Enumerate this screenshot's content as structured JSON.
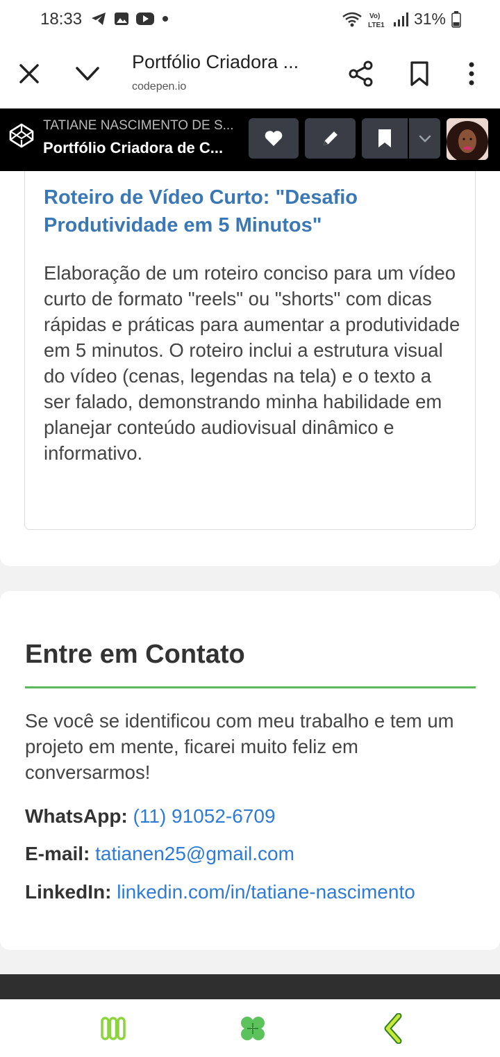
{
  "status_bar": {
    "time": "18:33",
    "battery": "31%"
  },
  "browser": {
    "title": "Portfólio Criadora ...",
    "domain": "codepen.io"
  },
  "codepen": {
    "author": "TATIANE NASCIMENTO DE S...",
    "pen_title": "Portfólio Criadora de C..."
  },
  "project": {
    "title": "Roteiro de Vídeo Curto: \"Desafio Produtividade em 5 Minutos\"",
    "description": "Elaboração de um roteiro conciso para um vídeo curto de formato \"reels\" ou \"shorts\" com dicas rápidas e práticas para aumentar a produtividade em 5 minutos. O roteiro inclui a estrutura visual do vídeo (cenas, legendas na tela) e o texto a ser falado, demonstrando minha habilidade em planejar conteúdo audiovisual dinâmico e informativo."
  },
  "contact": {
    "title": "Entre em Contato",
    "intro": "Se você se identificou com meu trabalho e tem um projeto em mente, ficarei muito feliz em conversarmos!",
    "whatsapp_label": "WhatsApp:",
    "whatsapp_value": "(11) 91052-6709",
    "email_label": "E-mail:",
    "email_value": "tatianen25@gmail.com",
    "linkedin_label": "LinkedIn:",
    "linkedin_value": "linkedin.com/in/tatiane-nascimento"
  },
  "colors": {
    "link": "#2e7bd6",
    "project_title": "#3a78b5",
    "accent_line": "#5cb85c",
    "nav_icon": "#8bd43c"
  },
  "icons": {
    "status": [
      "telegram-icon",
      "gallery-icon",
      "youtube-icon",
      "dot-icon",
      "wifi-icon",
      "volte-icon",
      "signal-icon",
      "battery-icon"
    ],
    "browser": [
      "close-icon",
      "chevron-down-icon",
      "share-icon",
      "bookmark-icon",
      "more-vert-icon"
    ],
    "codepen": [
      "codepen-logo-icon",
      "heart-icon",
      "pencil-icon",
      "bookmark-icon",
      "chevron-down-icon"
    ],
    "nav": [
      "recent-apps-icon",
      "home-clover-icon",
      "back-icon"
    ]
  }
}
